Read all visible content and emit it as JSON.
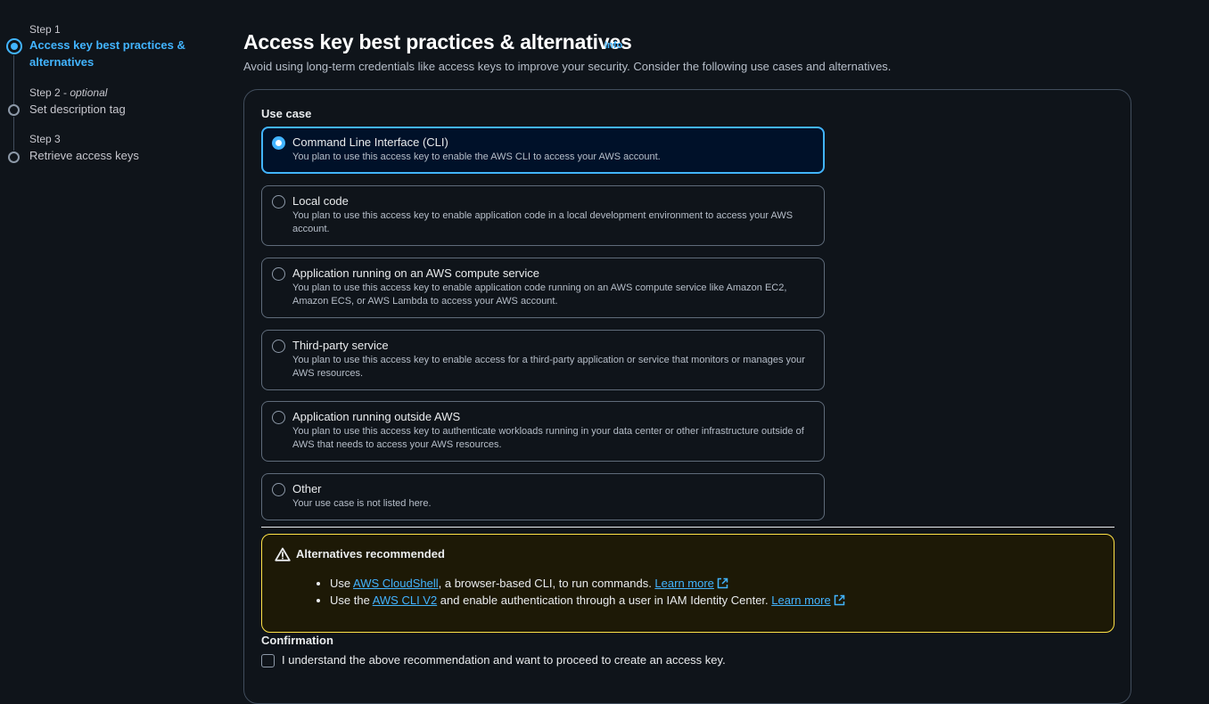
{
  "steps": [
    {
      "number": "Step 1",
      "title_line1": "Access key best practices &",
      "title_line2": "alternatives"
    },
    {
      "number": "Step 2",
      "optional": "optional",
      "title": "Set description tag"
    },
    {
      "number": "Step 3",
      "title": "Retrieve access keys"
    }
  ],
  "header": {
    "title": "Access key best practices & alternatives",
    "info": "Info",
    "description": "Avoid using long-term credentials like access keys to improve your security. Consider the following use cases and alternatives."
  },
  "use_case": {
    "label": "Use case",
    "selected": "Command Line Interface (CLI)",
    "options": [
      {
        "title": "Command Line Interface (CLI)",
        "description": "You plan to use this access key to enable the AWS CLI to access your AWS account."
      },
      {
        "title": "Local code",
        "description": "You plan to use this access key to enable application code in a local development environment to access your AWS account."
      },
      {
        "title": "Application running on an AWS compute service",
        "description": "You plan to use this access key to enable application code running on an AWS compute service like Amazon EC2, Amazon ECS, or AWS Lambda to access your AWS account."
      },
      {
        "title": "Third-party service",
        "description": "You plan to use this access key to enable access for a third-party application or service that monitors or manages your AWS resources."
      },
      {
        "title": "Application running outside AWS",
        "description": "You plan to use this access key to authenticate workloads running in your data center or other infrastructure outside of AWS that needs to access your AWS resources."
      },
      {
        "title": "Other",
        "description": "Your use case is not listed here."
      }
    ]
  },
  "alert": {
    "title": "Alternatives recommended",
    "item1": {
      "prefix": "Use ",
      "link": "AWS CloudShell",
      "middle": ", a browser-based CLI, to run commands. ",
      "learn": "Learn more"
    },
    "item2": {
      "prefix": "Use the ",
      "link": "AWS CLI V2",
      "middle": " and enable authentication through a user in IAM Identity Center. ",
      "learn": "Learn more"
    }
  },
  "confirmation": {
    "label": "Confirmation",
    "checkbox_label": "I understand the above recommendation and want to proceed to create an access key.",
    "checked": false
  },
  "colors": {
    "accent": "#42b4ff",
    "warning_border": "#ffe347",
    "background": "#0f141a"
  }
}
